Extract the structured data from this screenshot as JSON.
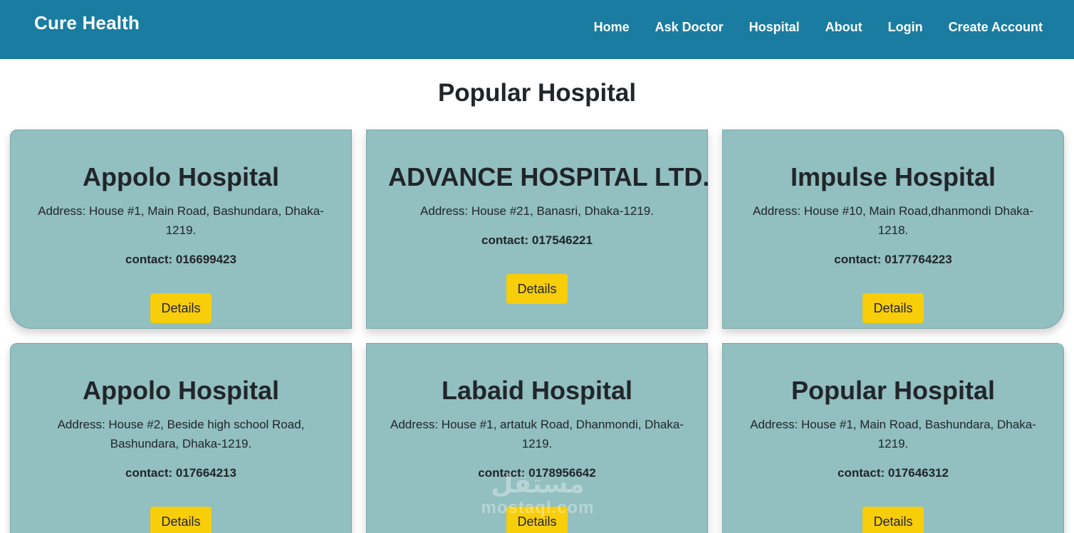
{
  "navbar": {
    "brand": "Cure Health",
    "links": [
      "Home",
      "Ask Doctor",
      "Hospital",
      "About",
      "Login",
      "Create Account"
    ]
  },
  "page": {
    "title": "Popular Hospital"
  },
  "hospitals": [
    {
      "name": "Appolo Hospital",
      "address": "Address: House #1, Main Road, Bashundara, Dhaka-1219.",
      "contact": "contact: 016699423",
      "button": "Details"
    },
    {
      "name": "ADVANCE HOSPITAL LTD.",
      "address": "Address: House #21, Banasri, Dhaka-1219.",
      "contact": "contact: 017546221",
      "button": "Details"
    },
    {
      "name": "Impulse Hospital",
      "address": "Address: House #10, Main Road,dhanmondi Dhaka-1218.",
      "contact": "contact: 0177764223",
      "button": "Details"
    },
    {
      "name": "Appolo Hospital",
      "address": "Address: House #2, Beside high school Road, Bashundara, Dhaka-1219.",
      "contact": "contact: 017664213",
      "button": "Details"
    },
    {
      "name": "Labaid Hospital",
      "address": "Address: House #1, artatuk Road, Dhanmondi, Dhaka-1219.",
      "contact": "contact: 0178956642",
      "button": "Details"
    },
    {
      "name": "Popular Hospital",
      "address": "Address: House #1, Main Road, Bashundara, Dhaka-1219.",
      "contact": "contact: 017646312",
      "button": "Details"
    }
  ],
  "watermark": {
    "top": "مستقل",
    "bottom": "mostaql.com"
  },
  "colors": {
    "navbar": "#1a7ca1",
    "card": "#92bfc0",
    "button": "#f8cd0a",
    "text": "#212529"
  }
}
